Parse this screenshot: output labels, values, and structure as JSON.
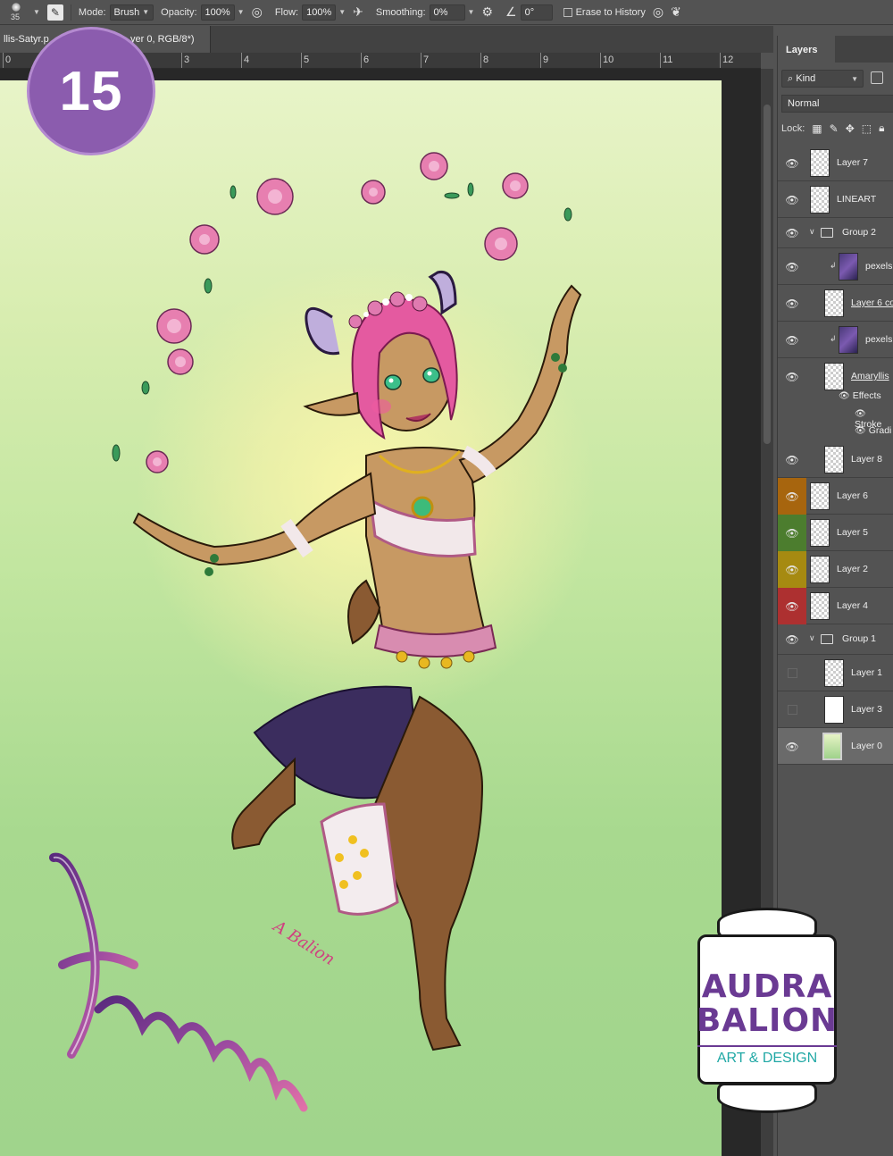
{
  "options_bar": {
    "brush_size": "35",
    "mode_label": "Mode:",
    "mode_value": "Brush",
    "opacity_label": "Opacity:",
    "opacity_value": "100%",
    "flow_label": "Flow:",
    "flow_value": "100%",
    "smoothing_label": "Smoothing:",
    "smoothing_value": "0%",
    "angle_value": "0°",
    "erase_history_label": "Erase to History"
  },
  "document_tab": {
    "title_start": "llis-Satyr.p",
    "title_end": "yer 0, RGB/8*)"
  },
  "ruler": {
    "ticks": [
      "0",
      "3",
      "4",
      "5",
      "6",
      "7",
      "8",
      "9",
      "10",
      "11",
      "12"
    ]
  },
  "step_badge": "15",
  "layers_panel": {
    "tab_label": "Layers",
    "filter_kind": "Kind",
    "blend_mode": "Normal",
    "lock_label": "Lock:",
    "layers": [
      {
        "name": "Layer 7"
      },
      {
        "name": "LINEART"
      },
      {
        "name": "Group 2"
      },
      {
        "name": "pexels"
      },
      {
        "name": "Layer 6 co"
      },
      {
        "name": "pexels"
      },
      {
        "name": "Amaryllis"
      },
      {
        "name": "Layer 8"
      },
      {
        "name": "Layer 6"
      },
      {
        "name": "Layer 5"
      },
      {
        "name": "Layer 2"
      },
      {
        "name": "Layer 4"
      },
      {
        "name": "Group 1"
      },
      {
        "name": "Layer 1"
      },
      {
        "name": "Layer 3"
      },
      {
        "name": "Layer 0"
      }
    ],
    "effects": {
      "label": "Effects",
      "items": [
        "Stroke",
        "Gradi"
      ]
    }
  },
  "logo": {
    "line1": "AUDRA",
    "line2": "BALION",
    "line3": "ART & DESIGN"
  },
  "colors": {
    "badge": "#8b5cae",
    "logo_purple": "#6a3a93",
    "logo_teal": "#20a8a5"
  }
}
